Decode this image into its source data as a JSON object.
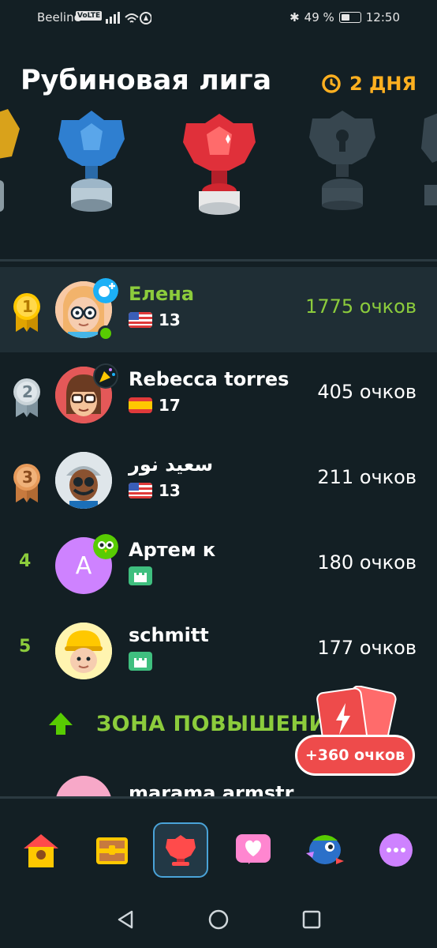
{
  "status_bar": {
    "carrier": "Beeline",
    "volte": "VoLTE",
    "battery": "49 %",
    "time": "12:50"
  },
  "header": {
    "title": "Рубиновая лига",
    "timer": "2 ДНЯ",
    "timer_icon": "clock-icon"
  },
  "leaderboard": [
    {
      "rank": "1",
      "name": "Елена",
      "flag": "us",
      "level": "13",
      "score": "1775 очков",
      "highlight": true
    },
    {
      "rank": "2",
      "name": "Rebecca torres",
      "flag": "es",
      "level": "17",
      "score": "405 очков",
      "highlight": false
    },
    {
      "rank": "3",
      "name": "سعيد نور",
      "flag": "us",
      "level": "13",
      "score": "211 очков",
      "highlight": false
    },
    {
      "rank": "4",
      "name": "Артем к",
      "avatar_letter": "A",
      "score": "180 очков",
      "highlight": false
    },
    {
      "rank": "5",
      "name": "schmitt",
      "score": "177 очков",
      "highlight": false
    }
  ],
  "promotion": {
    "label": "ЗОНА ПОВЫШЕНИ",
    "bonus": "+360 очков"
  },
  "partial_row": {
    "name": "marama armstr"
  },
  "tabs": [
    {
      "name": "home-tab",
      "icon": "house-icon"
    },
    {
      "name": "chest-tab",
      "icon": "chest-icon"
    },
    {
      "name": "league-tab",
      "icon": "trophy-icon",
      "active": true
    },
    {
      "name": "hearts-tab",
      "icon": "heart-icon"
    },
    {
      "name": "character-tab",
      "icon": "bird-icon"
    },
    {
      "name": "more-tab",
      "icon": "more-icon"
    }
  ],
  "colors": {
    "background": "#131f24",
    "accent_green": "#8ccc3c",
    "timer_orange": "#ffb020",
    "bonus_red": "#ee4b4b"
  }
}
